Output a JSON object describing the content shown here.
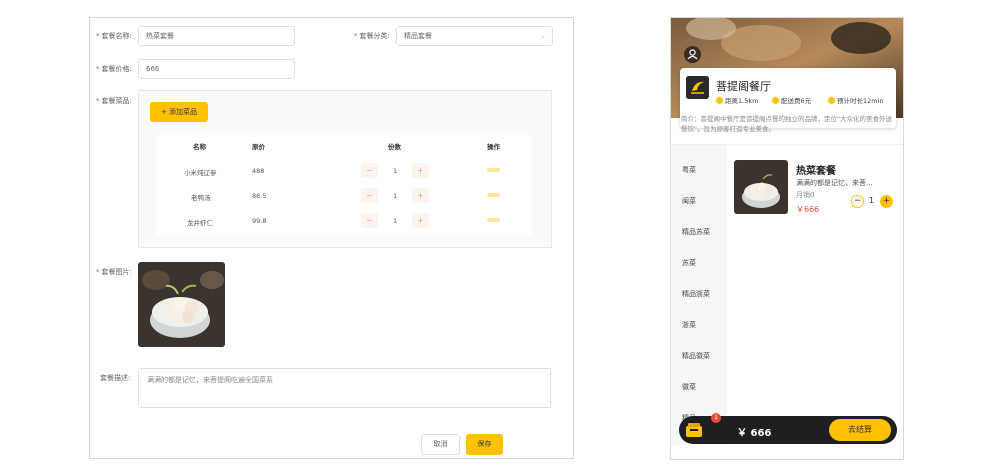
{
  "admin_form": {
    "name_label": "套餐名称:",
    "name_value": "热菜套餐",
    "category_label": "套餐分类:",
    "category_value": "精品套餐",
    "price_label": "套餐价格:",
    "price_value": "666",
    "dishes_label": "套餐菜品:",
    "add_dish_label": "+ 添加菜品",
    "table_headers": {
      "name": "名称",
      "price": "原价",
      "portions": "份数",
      "actions": "操作"
    },
    "dishes": [
      {
        "name": "小米炖辽参",
        "price": "488",
        "qty": "1"
      },
      {
        "name": "老鸭汤",
        "price": "86.5",
        "qty": "1"
      },
      {
        "name": "龙井虾仁",
        "price": "99.8",
        "qty": "1"
      }
    ],
    "stepper_minus": "−",
    "stepper_plus": "+",
    "image_label": "套餐图片:",
    "desc_label": "套餐描述:",
    "desc_value": "满满的都是记忆，来菩提阁吃遍全国菜系",
    "cancel_label": "取消",
    "save_label": "保存"
  },
  "mobile_preview": {
    "shop_name": "菩提阁餐厅",
    "distance": "距离1.5km",
    "delivery_fee": "配送费6元",
    "delivery_time": "预计时长12min",
    "intro": "简介：菩提阁中餐厅是菩提阁点餐的独立的品牌，定位\"大众化的美食外送餐饮\"，旨为顾客打造专业美食。",
    "categories": [
      "粤菜",
      "闽菜",
      "精品苏菜",
      "苏菜",
      "精品浙菜",
      "浙菜",
      "精品徽菜",
      "徽菜",
      "精品"
    ],
    "item": {
      "name": "热菜套餐",
      "desc": "满满的都是记忆，来菩...",
      "sales": "月销0",
      "price": "￥666",
      "qty": "1",
      "minus": "−",
      "plus": "+"
    },
    "cart_badge": "1",
    "cart_total": "￥ 666",
    "checkout_label": "去结算"
  },
  "colors": {
    "accent": "#ffc200",
    "price_red": "#e94e3c",
    "dark_bar": "#1f1f1f"
  },
  "icons": [
    "chevron-down-icon",
    "user-icon",
    "shop-logo-icon",
    "location-icon",
    "delivery-fee-icon",
    "clock-icon",
    "cart-icon"
  ]
}
